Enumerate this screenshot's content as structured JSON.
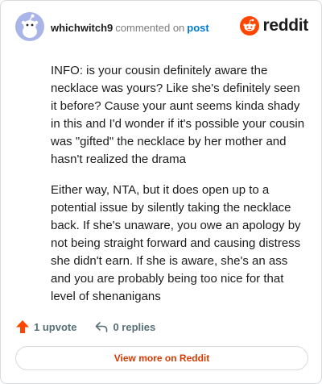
{
  "header": {
    "username": "whichwitch9",
    "action_text": "commented on",
    "post_link": "post",
    "logo_text": "reddit"
  },
  "comment": {
    "paragraphs": [
      "INFO: is your cousin definitely aware the necklace was yours? Like she's definitely seen it before? Cause your aunt seems kinda shady in this and I'd wonder if it's possible your cousin was \"gifted\" the necklace by her mother and hasn't realized the drama",
      "Either way, NTA, but it does open up to a potential issue by silently taking the necklace back. If she's unaware, you owe an apology by not being straight forward and causing distress she didn't earn. If she is aware, she's an ass and you are probably being too nice for that level of shenanigans"
    ]
  },
  "actions": {
    "upvotes": "1 upvote",
    "replies": "0 replies"
  },
  "footer": {
    "view_more_label": "View more on Reddit"
  },
  "colors": {
    "brand": "#ff4500",
    "link": "#0079d3",
    "view_more": "#d93a00",
    "avatar_bg": "#a9b5e8"
  },
  "icons": [
    "avatar-snoo-icon",
    "reddit-logo-icon",
    "upvote-arrow-icon",
    "reply-arrow-icon"
  ]
}
